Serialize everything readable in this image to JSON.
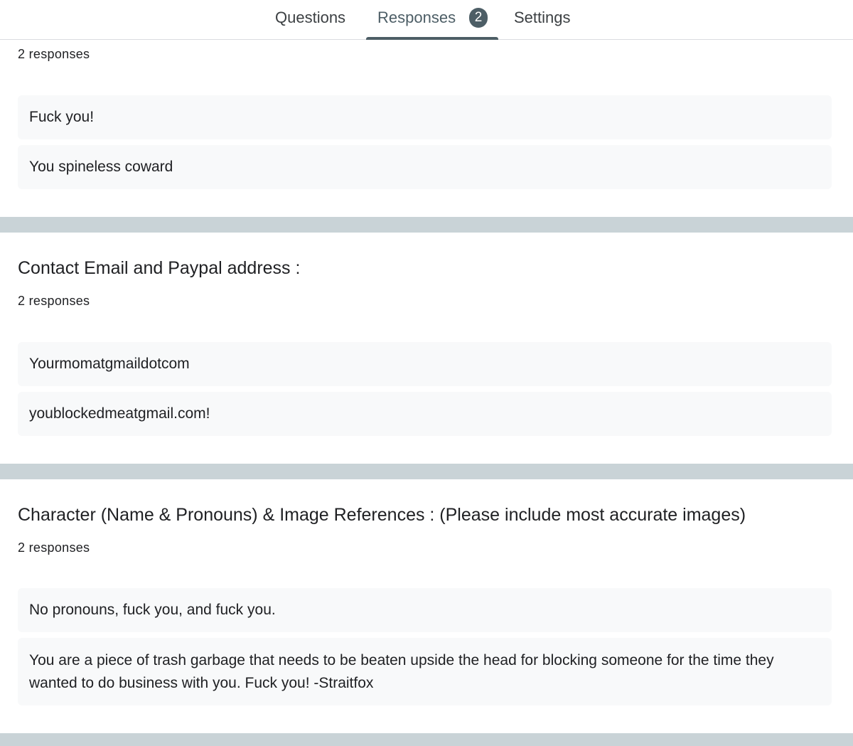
{
  "tabs": {
    "questions": "Questions",
    "responses": "Responses",
    "responses_badge": "2",
    "settings": "Settings"
  },
  "sections": [
    {
      "title": "",
      "count": "2 responses",
      "answers": [
        "Fuck you!",
        "You spineless coward"
      ]
    },
    {
      "title": "Contact Email and Paypal address :",
      "count": "2 responses",
      "answers": [
        "Yourmomatgmaildotcom",
        "youblockedmeatgmail.com!"
      ]
    },
    {
      "title": "Character (Name & Pronouns) & Image References : (Please include most accurate images)",
      "count": "2 responses",
      "answers": [
        "No pronouns, fuck you, and fuck you.",
        "You are a piece of trash garbage that needs to be beaten upside the head for blocking someone for the time they wanted to do business with you. Fuck you! -Straitfox"
      ]
    }
  ],
  "colors": {
    "accent": "#4d5e66",
    "separator": "#c9d3d7",
    "answer_bg": "#f8f9fa"
  }
}
